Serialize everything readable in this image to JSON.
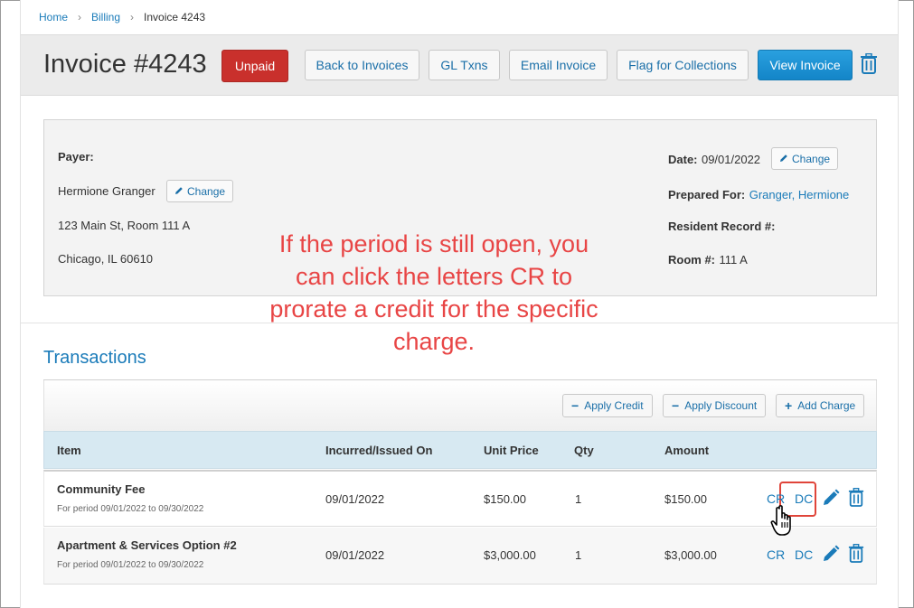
{
  "breadcrumb": {
    "items": [
      {
        "label": "Home"
      },
      {
        "label": "Billing"
      }
    ],
    "current": "Invoice 4243"
  },
  "header": {
    "title": "Invoice #4243",
    "status": "Unpaid",
    "status_color": "#c9302c",
    "buttons": {
      "back": "Back to Invoices",
      "gl": "GL Txns",
      "email": "Email Invoice",
      "flag": "Flag for Collections",
      "view": "View Invoice"
    },
    "delete_icon": "trash-icon"
  },
  "payer": {
    "label": "Payer:",
    "name": "Hermione Granger",
    "change": "Change",
    "address1": "123 Main St, Room 111 A",
    "address2": "Chicago, IL 60610"
  },
  "meta": {
    "date_label": "Date:",
    "date_value": "09/01/2022",
    "date_change": "Change",
    "prepared_label": "Prepared For:",
    "prepared_value": "Granger, Hermione",
    "resident_label": "Resident Record #:",
    "room_label": "Room #:",
    "room_value": "111 A"
  },
  "annotation": "If the period is still open, you can click the letters CR to prorate a credit for the specific charge.",
  "transactions": {
    "title": "Transactions",
    "toolbar": {
      "apply_credit": "Apply Credit",
      "apply_discount": "Apply Discount",
      "add_charge": "Add Charge"
    },
    "columns": {
      "item": "Item",
      "incurred": "Incurred/Issued On",
      "unit_price": "Unit Price",
      "qty": "Qty",
      "amount": "Amount"
    },
    "rows": [
      {
        "name": "Community Fee",
        "period": "For period 09/01/2022 to 09/30/2022",
        "incurred": "09/01/2022",
        "unit_price": "$150.00",
        "qty": "1",
        "amount": "$150.00",
        "cr": "CR",
        "dc": "DC"
      },
      {
        "name": "Apartment & Services Option #2",
        "period": "For period 09/01/2022 to 09/30/2022",
        "incurred": "09/01/2022",
        "unit_price": "$3,000.00",
        "qty": "1",
        "amount": "$3,000.00",
        "cr": "CR",
        "dc": "DC"
      }
    ]
  },
  "colors": {
    "link": "#1a7bb9",
    "primary": "#1a8fd1",
    "annotation": "#e84545",
    "table_header": "#d7e9f2"
  }
}
